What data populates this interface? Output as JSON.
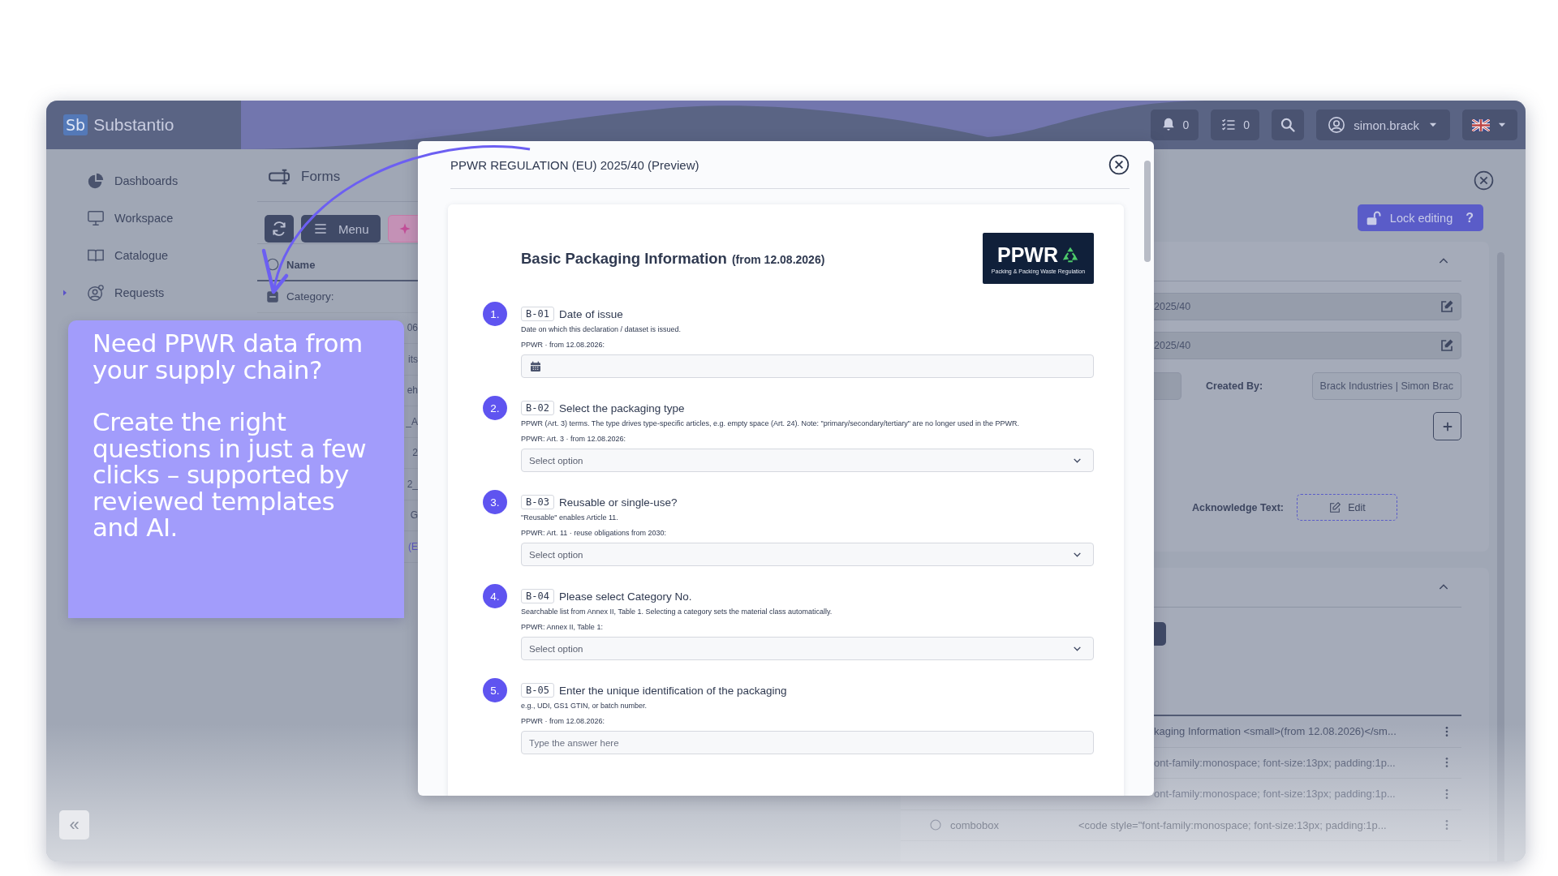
{
  "app": {
    "logo": "Sb",
    "name": "Substantio"
  },
  "header": {
    "notifications": "0",
    "tasks": "0",
    "user": "simon.brack"
  },
  "sidebar": {
    "items": [
      {
        "label": "Dashboards",
        "expandable": false
      },
      {
        "label": "Workspace",
        "expandable": false
      },
      {
        "label": "Catalogue",
        "expandable": false
      },
      {
        "label": "Requests",
        "expandable": true
      }
    ],
    "collapse": "«"
  },
  "forms": {
    "title": "Forms",
    "menu_button": "Menu",
    "columns": [
      "Name"
    ],
    "rows": [
      {
        "text": "Category:",
        "kind": "category"
      },
      {
        "text": "06",
        "kind": "fragment"
      },
      {
        "text": "its",
        "kind": "fragment"
      },
      {
        "text": "eh",
        "kind": "fragment"
      },
      {
        "text": "_A",
        "kind": "fragment"
      },
      {
        "text": "2",
        "kind": "fragment"
      },
      {
        "text": "2_",
        "kind": "fragment"
      },
      {
        "text": "G",
        "kind": "fragment"
      },
      {
        "text": "(E",
        "kind": "link"
      }
    ]
  },
  "detail": {
    "lock_button": "Lock editing",
    "help_button": "?",
    "fields": [
      "2025/40",
      "2025/40"
    ],
    "created_by_label": "Created By:",
    "created_by": "Brack Industries | Simon Brac",
    "acknowledge_label": "Acknowledge Text:",
    "edit_button": "Edit",
    "rows": [
      {
        "text": "kaging Information <small>(from 12.08.2026)</sm..."
      },
      {
        "text": "ont-family:monospace; font-size:13px; padding:1p..."
      },
      {
        "text": "ont-family:monospace; font-size:13px; padding:1p..."
      },
      {
        "type": "combobox",
        "text": "<code style=\"font-family:monospace; font-size:13px; padding:1p..."
      }
    ]
  },
  "modal": {
    "title": "PPWR REGULATION (EU) 2025/40 (Preview)",
    "heading": "Basic Packaging Information",
    "heading_note": "(from 12.08.2026)",
    "logo": {
      "title": "PPWR",
      "subtitle": "Packing & Packing Waste Regulation"
    },
    "questions": [
      {
        "number": "1.",
        "code": "B-01",
        "label": "Date of issue",
        "description": "Date on which this declaration / dataset is issued.",
        "meta": "PPWR · from 12.08.2026:",
        "kind": "date"
      },
      {
        "number": "2.",
        "code": "B-02",
        "label": "Select the packaging type",
        "description": "PPWR (Art. 3) terms. The type drives type-specific articles, e.g. empty space (Art. 24). Note: \"primary/secondary/tertiary\" are no longer used in the PPWR.",
        "meta": "PPWR: Art. 3 · from 12.08.2026:",
        "kind": "select",
        "placeholder": "Select option"
      },
      {
        "number": "3.",
        "code": "B-03",
        "label": "Reusable or single-use?",
        "description": "\"Reusable\" enables Article 11.",
        "meta": "PPWR: Art. 11 · reuse obligations from 2030:",
        "kind": "select",
        "placeholder": "Select option"
      },
      {
        "number": "4.",
        "code": "B-04",
        "label": "Please select Category No.",
        "description": "Searchable list from Annex II, Table 1. Selecting a category sets the material class automatically.",
        "meta": "PPWR: Annex II, Table 1:",
        "kind": "select",
        "placeholder": "Select option"
      },
      {
        "number": "5.",
        "code": "B-05",
        "label": "Enter the unique identification of the packaging",
        "description": "e.g., UDI, GS1 GTIN, or batch number.",
        "meta": "PPWR · from 12.08.2026:",
        "kind": "text",
        "placeholder": "Type the answer here"
      }
    ]
  },
  "callout": {
    "paragraphs": [
      "Need PPWR data from your supply chain?",
      "Create the right questions in just a few clicks – supported by reviewed templates and AI."
    ]
  }
}
